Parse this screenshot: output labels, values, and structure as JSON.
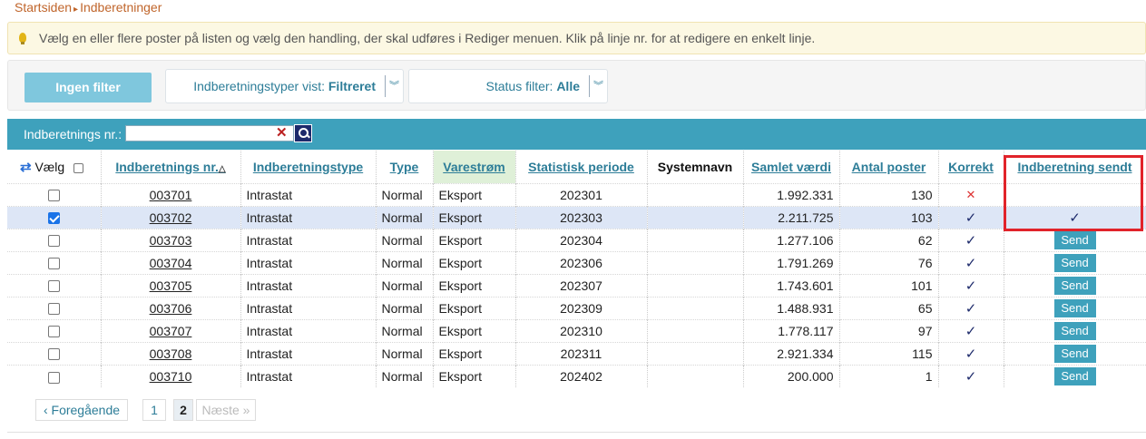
{
  "breadcrumb": {
    "home": "Startsiden",
    "current": "Indberetninger"
  },
  "info": {
    "text": "Vælg en eller flere poster på listen og vælg den handling, der skal udføres i Rediger menuen. Klik på linje nr. for at redigere en enkelt linje."
  },
  "filters": {
    "no_filter_label": "Ingen filter",
    "types_label": "Indberetningstyper vist:",
    "types_value": "Filtreret",
    "status_label": "Status filter:",
    "status_value": "Alle"
  },
  "search": {
    "label": "Indberetnings nr.:",
    "value": "",
    "placeholder": ""
  },
  "table": {
    "headers": {
      "select": "Vælg",
      "nr": "Indberetnings nr.",
      "type_name": "Indberetningstype",
      "type": "Type",
      "flow": "Varestrøm",
      "period": "Statistisk periode",
      "system": "Systemnavn",
      "value": "Samlet værdi",
      "count": "Antal poster",
      "correct": "Korrekt",
      "sent": "Indberetning sendt"
    },
    "send_label": "Send",
    "rows": [
      {
        "nr": "003701",
        "type_name": "Intrastat",
        "type": "Normal",
        "flow": "Eksport",
        "period": "202301",
        "system": "",
        "value": "1.992.331",
        "count": "130",
        "correct": "✕",
        "sent": "",
        "checked": false
      },
      {
        "nr": "003702",
        "type_name": "Intrastat",
        "type": "Normal",
        "flow": "Eksport",
        "period": "202303",
        "system": "",
        "value": "2.211.725",
        "count": "103",
        "correct": "✓",
        "sent": "✓",
        "checked": true
      },
      {
        "nr": "003703",
        "type_name": "Intrastat",
        "type": "Normal",
        "flow": "Eksport",
        "period": "202304",
        "system": "",
        "value": "1.277.106",
        "count": "62",
        "correct": "✓",
        "sent": "Send",
        "checked": false
      },
      {
        "nr": "003704",
        "type_name": "Intrastat",
        "type": "Normal",
        "flow": "Eksport",
        "period": "202306",
        "system": "",
        "value": "1.791.269",
        "count": "76",
        "correct": "✓",
        "sent": "Send",
        "checked": false
      },
      {
        "nr": "003705",
        "type_name": "Intrastat",
        "type": "Normal",
        "flow": "Eksport",
        "period": "202307",
        "system": "",
        "value": "1.743.601",
        "count": "101",
        "correct": "✓",
        "sent": "Send",
        "checked": false
      },
      {
        "nr": "003706",
        "type_name": "Intrastat",
        "type": "Normal",
        "flow": "Eksport",
        "period": "202309",
        "system": "",
        "value": "1.488.931",
        "count": "65",
        "correct": "✓",
        "sent": "Send",
        "checked": false
      },
      {
        "nr": "003707",
        "type_name": "Intrastat",
        "type": "Normal",
        "flow": "Eksport",
        "period": "202310",
        "system": "",
        "value": "1.778.117",
        "count": "97",
        "correct": "✓",
        "sent": "Send",
        "checked": false
      },
      {
        "nr": "003708",
        "type_name": "Intrastat",
        "type": "Normal",
        "flow": "Eksport",
        "period": "202311",
        "system": "",
        "value": "2.921.334",
        "count": "115",
        "correct": "✓",
        "sent": "Send",
        "checked": false
      },
      {
        "nr": "003710",
        "type_name": "Intrastat",
        "type": "Normal",
        "flow": "Eksport",
        "period": "202402",
        "system": "",
        "value": "200.000",
        "count": "1",
        "correct": "✓",
        "sent": "Send",
        "checked": false
      }
    ]
  },
  "pager": {
    "prev": "‹ Foregående",
    "pages": [
      "1",
      "2"
    ],
    "current": "2",
    "next": "Næste »"
  },
  "colors": {
    "accent": "#3ea1bc",
    "link": "#2d7d98",
    "highlight": "#e1232a",
    "breadcrumb": "#c0652b"
  }
}
